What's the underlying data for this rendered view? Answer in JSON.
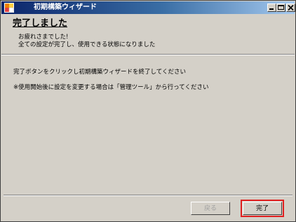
{
  "window": {
    "title": "初期構築ウィザード",
    "icon": "app-icon",
    "controls": [
      "minimize-icon",
      "maximize-icon",
      "close-icon"
    ]
  },
  "header": {
    "title": "完了しました",
    "subtitle_lines": [
      "お疲れさまでした!",
      "全ての設定が完了し、使用できる状態になりました"
    ]
  },
  "body": {
    "lines": [
      "完了ボタンをクリックし初期構築ウィザードを終了してください",
      "※使用開始後に設定を変更する場合は「管理ツール」から行ってください"
    ]
  },
  "footer": {
    "back_label": "戻る",
    "back_enabled": false,
    "finish_label": "完了"
  },
  "colors": {
    "face": "#d4d0c8",
    "titlebar_start": "#0a246a",
    "titlebar_end": "#a6caf0",
    "focus_outline": "#e02020"
  }
}
